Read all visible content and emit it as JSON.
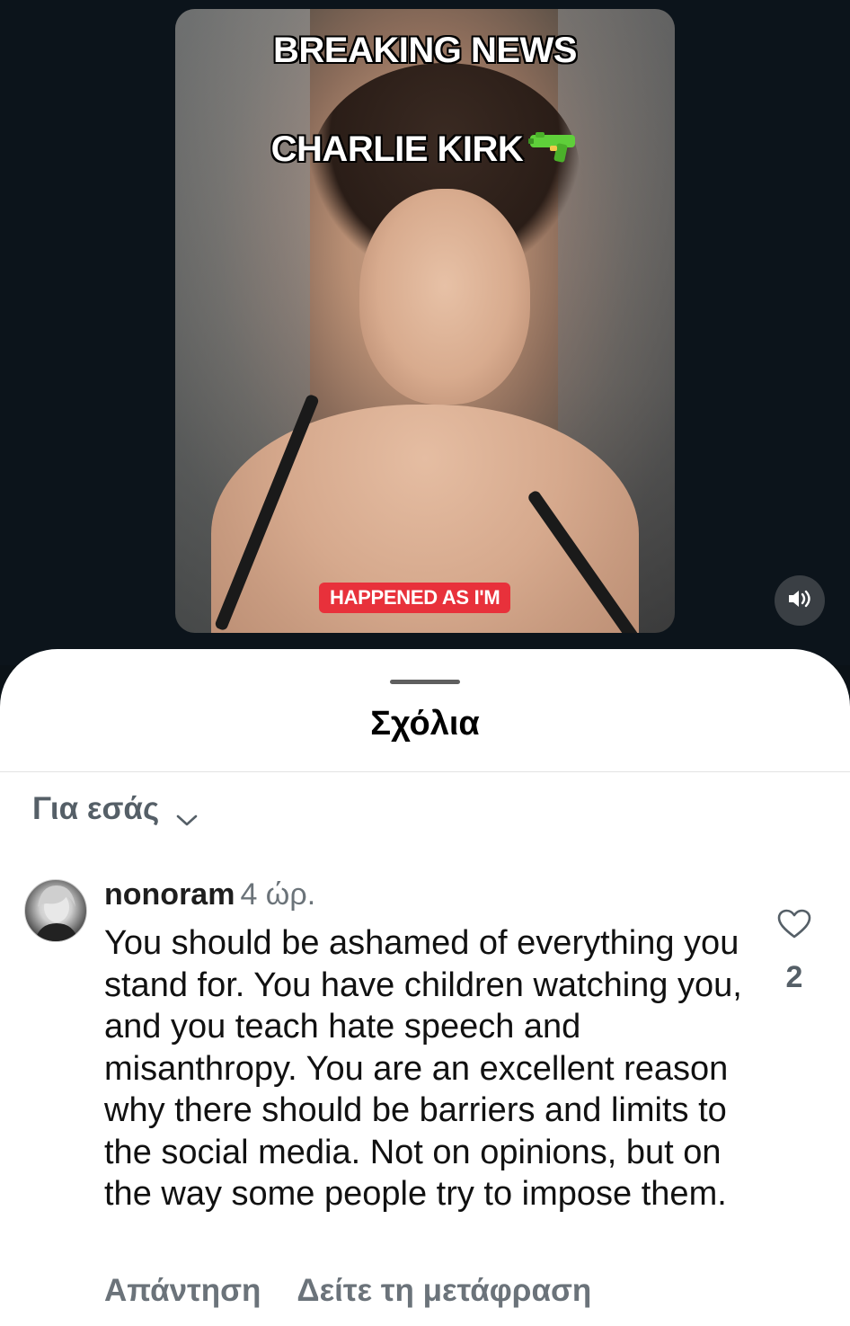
{
  "video": {
    "overlay_line1": "BREAKING NEWS",
    "overlay_line2": "CHARLIE KIRK",
    "overlay_icon": "water-pistol-icon",
    "caption": "HAPPENED AS I'M",
    "caption_color": "#e8313b",
    "volume_icon": "speaker-icon"
  },
  "comments_sheet": {
    "title": "Σχόλια",
    "filter_label": "Για εσάς",
    "filter_icon": "chevron-down-icon"
  },
  "comment": {
    "username": "nonoram",
    "time": "4 ώρ.",
    "text": "You should be ashamed of everything you stand for. You have children watching you, and you teach hate speech and misanthropy. You are an excellent reason why there should be barriers and limits to the social media. Not on opinions, but on the way some people try to impose them.",
    "like_count": "2",
    "like_icon": "heart-icon",
    "reply_label": "Απάντηση",
    "translate_label": "Δείτε τη μετάφραση"
  }
}
